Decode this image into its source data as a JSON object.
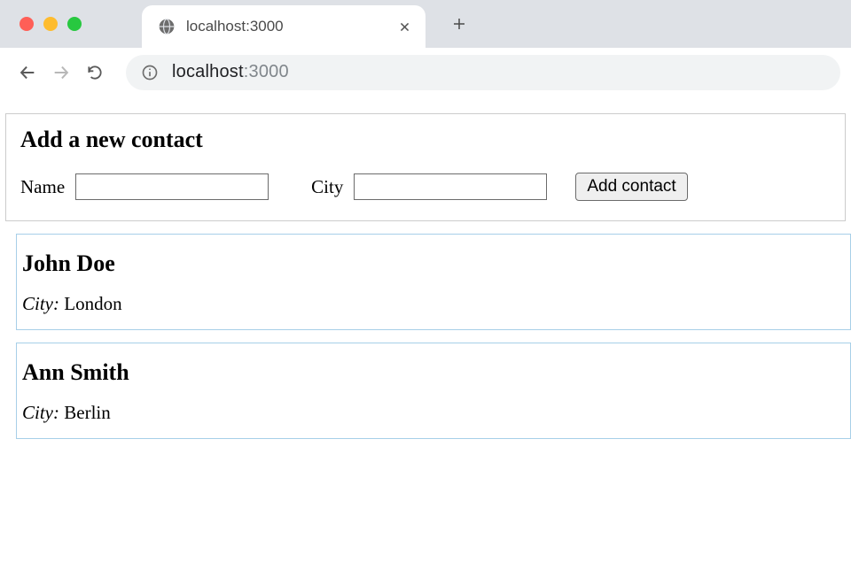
{
  "browser": {
    "tab_title": "localhost:3000",
    "url_host": "localhost",
    "url_port": ":3000"
  },
  "form": {
    "heading": "Add a new contact",
    "name_label": "Name",
    "name_value": "",
    "city_label": "City",
    "city_value": "",
    "submit_label": "Add contact"
  },
  "contacts": [
    {
      "name": "John Doe",
      "city_label": "City:",
      "city": "London"
    },
    {
      "name": "Ann Smith",
      "city_label": "City:",
      "city": "Berlin"
    }
  ]
}
